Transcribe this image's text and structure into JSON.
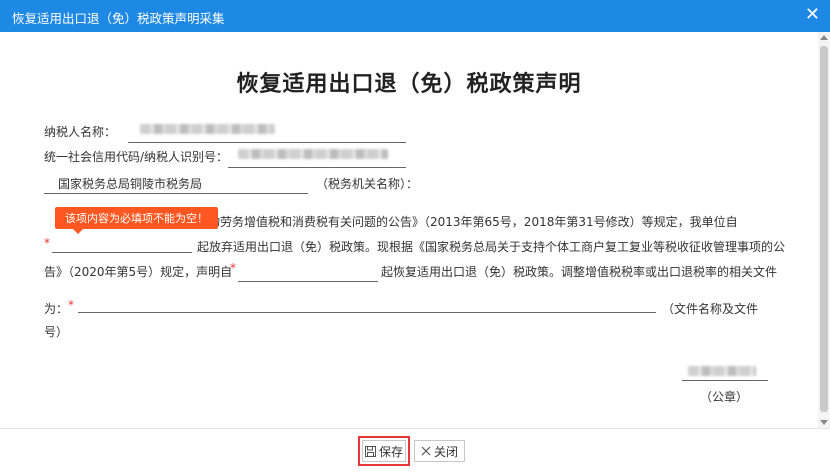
{
  "window": {
    "title": "恢复适用出口退（免）税政策声明采集"
  },
  "doc": {
    "title": "恢复适用出口退（免）税政策声明",
    "taxpayer_name_label": "纳税人名称：",
    "credit_code_label": "统一社会信用代码/纳税人识别号：",
    "tax_office_value": "国家税务总局铜陵市税务局",
    "tax_office_suffix": "（税务机关名称）：",
    "p1_rest": "口货物劳务增值税和消费税有关问题的公告》（2013年第65号，2018年第31号修改）等规定，我单位自",
    "req_mark": "*",
    "p2_text": "起放弃适用出口退（免）税政策。现根据《国家税务总局关于支持个体工商户复工复业等税收征收管理事项的公",
    "p3_left": "告》（2020年第5号）规定，声明自",
    "p3_right": "起恢复适用出口退（免）税政策。调整增值税税率或出口退税率的相关文件",
    "p4_left": "为：",
    "p4_suffix": "（文件名称及文件",
    "p5_text": "号）",
    "seal_label": "（公章）"
  },
  "tooltip": {
    "text": "该项内容为必填项不能为空！"
  },
  "footer": {
    "save_label": "保存",
    "close_label": "关闭"
  }
}
